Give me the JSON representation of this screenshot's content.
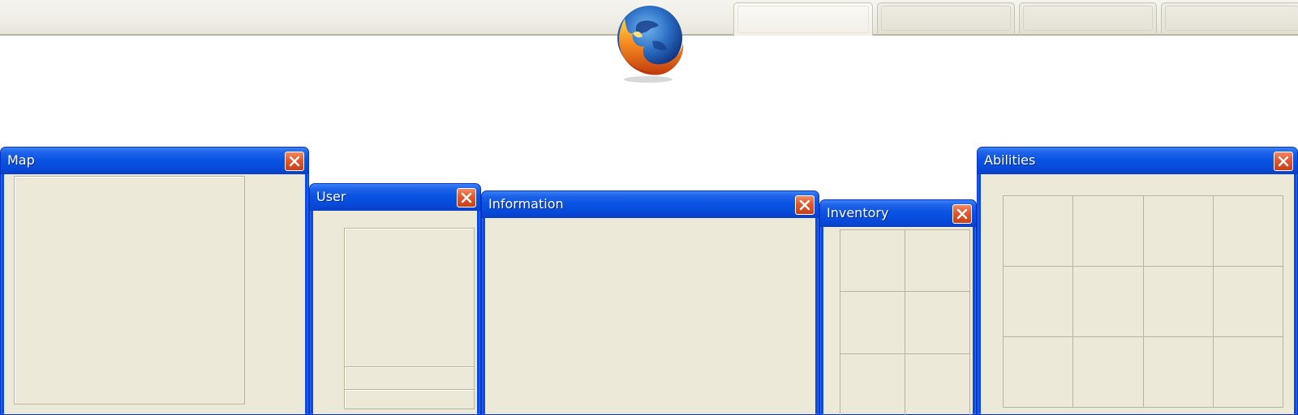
{
  "browser": {
    "logo_icon": "firefox-logo-icon",
    "tabs": [
      {
        "label": "",
        "active": true
      },
      {
        "label": "",
        "active": false
      },
      {
        "label": "",
        "active": false
      },
      {
        "label": "",
        "active": false
      }
    ]
  },
  "windows": {
    "map": {
      "title": "Map",
      "close_icon": "close-icon"
    },
    "user": {
      "title": "User",
      "close_icon": "close-icon"
    },
    "information": {
      "title": "Information",
      "close_icon": "close-icon"
    },
    "inventory": {
      "title": "Inventory",
      "close_icon": "close-icon",
      "slot_columns": 2,
      "slot_rows": 3
    },
    "abilities": {
      "title": "Abilities",
      "close_icon": "close-icon",
      "slot_columns": 4,
      "slot_rows": 3
    }
  },
  "colors": {
    "titlebar_blue": "#0a54e3",
    "close_red": "#e3572e",
    "window_body": "#ece9d8"
  }
}
